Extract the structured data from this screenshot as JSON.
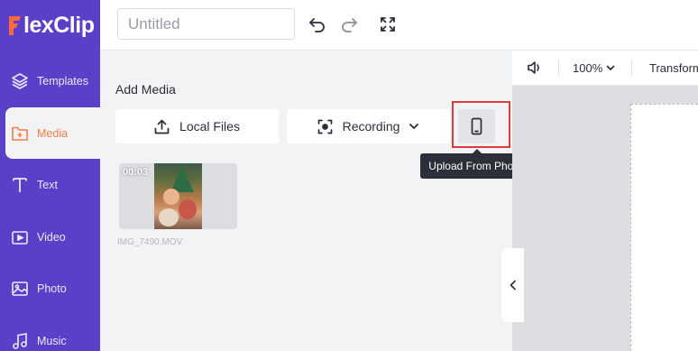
{
  "app": {
    "logo_text": "lexClip",
    "logo_full_name": "FlexClip",
    "brand_color": "#5a3fc9",
    "accent_color": "#ff7a45"
  },
  "sidebar": {
    "items": [
      {
        "label": "Templates",
        "icon": "layers-icon"
      },
      {
        "label": "Media",
        "icon": "media-folder-icon",
        "active": true
      },
      {
        "label": "Text",
        "icon": "text-icon"
      },
      {
        "label": "Video",
        "icon": "video-icon"
      },
      {
        "label": "Photo",
        "icon": "photo-icon"
      },
      {
        "label": "Music",
        "icon": "music-icon"
      }
    ]
  },
  "topbar": {
    "title_placeholder": "Untitled",
    "icons": [
      "undo-icon",
      "redo-icon",
      "fullscreen-icon"
    ]
  },
  "media_panel": {
    "title": "Add Media",
    "local_files_label": "Local Files",
    "recording_label": "Recording",
    "phone_tooltip": "Upload From Phone",
    "highlight_color": "#e03a3a",
    "items": [
      {
        "duration": "00:03",
        "filename": "IMG_7490.MOV"
      }
    ]
  },
  "canvas_toolbar": {
    "zoom": "100%",
    "transform_label": "Transform"
  }
}
